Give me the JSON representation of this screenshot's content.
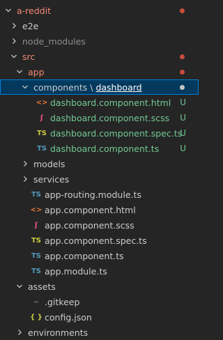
{
  "colors": {
    "git_deleted": "#f48771",
    "git_untracked": "#73c991",
    "folder": "#cccccc",
    "muted": "#8c8c8c",
    "dot_red": "#c74e39",
    "dot_grey": "#c5c5c5",
    "html_icon": "#e37933",
    "scss_icon": "#f55385",
    "spec_icon": "#cbcb41",
    "ts_icon": "#519aba",
    "json_icon": "#cbcb41"
  },
  "tree": [
    {
      "label": "a-reddit",
      "indent": 0,
      "type": "folder",
      "expanded": true,
      "color": "git_deleted",
      "dot": "dot_red"
    },
    {
      "label": "e2e",
      "indent": 1,
      "type": "folder",
      "expanded": false,
      "color": "folder"
    },
    {
      "label": "node_modules",
      "indent": 1,
      "type": "folder",
      "expanded": false,
      "color": "muted"
    },
    {
      "label": "src",
      "indent": 1,
      "type": "folder",
      "expanded": true,
      "color": "git_deleted",
      "dot": "dot_red"
    },
    {
      "label": "app",
      "indent": 2,
      "type": "folder",
      "expanded": true,
      "color": "git_deleted",
      "dot": "dot_red"
    },
    {
      "label": "components",
      "compact_sep": "\\",
      "compact_sub": "dashboard",
      "indent": 3,
      "type": "folder",
      "expanded": true,
      "color": "folder",
      "dot": "dot_grey",
      "selected": true
    },
    {
      "label": "dashboard.component.html",
      "indent": 4,
      "type": "file",
      "icon": "html",
      "color": "git_untracked",
      "badge": "U"
    },
    {
      "label": "dashboard.component.scss",
      "indent": 4,
      "type": "file",
      "icon": "scss",
      "color": "git_untracked",
      "badge": "U"
    },
    {
      "label": "dashboard.component.spec.ts",
      "indent": 4,
      "type": "file",
      "icon": "spec",
      "color": "git_untracked",
      "badge": "U"
    },
    {
      "label": "dashboard.component.ts",
      "indent": 4,
      "type": "file",
      "icon": "ts",
      "color": "git_untracked",
      "badge": "U"
    },
    {
      "label": "models",
      "indent": 3,
      "type": "folder",
      "expanded": false,
      "color": "folder"
    },
    {
      "label": "services",
      "indent": 3,
      "type": "folder",
      "expanded": false,
      "color": "folder"
    },
    {
      "label": "app-routing.module.ts",
      "indent": 3,
      "type": "file",
      "icon": "ts",
      "color": "folder"
    },
    {
      "label": "app.component.html",
      "indent": 3,
      "type": "file",
      "icon": "html",
      "color": "folder"
    },
    {
      "label": "app.component.scss",
      "indent": 3,
      "type": "file",
      "icon": "scss",
      "color": "folder"
    },
    {
      "label": "app.component.spec.ts",
      "indent": 3,
      "type": "file",
      "icon": "spec",
      "color": "folder"
    },
    {
      "label": "app.component.ts",
      "indent": 3,
      "type": "file",
      "icon": "ts",
      "color": "folder"
    },
    {
      "label": "app.module.ts",
      "indent": 3,
      "type": "file",
      "icon": "ts",
      "color": "folder"
    },
    {
      "label": "assets",
      "indent": 2,
      "type": "folder",
      "expanded": true,
      "color": "folder"
    },
    {
      "label": ".gitkeep",
      "indent": 3,
      "type": "file",
      "icon": "gitkeep",
      "color": "folder"
    },
    {
      "label": "config.json",
      "indent": 3,
      "type": "file",
      "icon": "json",
      "color": "folder"
    },
    {
      "label": "environments",
      "indent": 2,
      "type": "folder",
      "expanded": false,
      "color": "folder"
    }
  ]
}
